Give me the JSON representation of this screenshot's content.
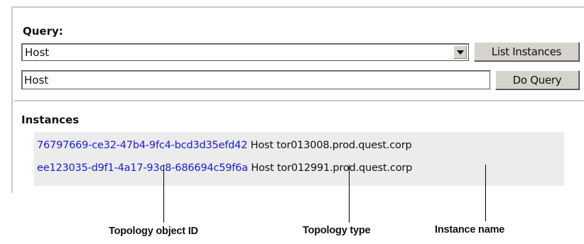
{
  "query": {
    "label": "Query:",
    "select_value": "Host",
    "list_button": "List Instances",
    "input_value": "Host",
    "do_button": "Do Query"
  },
  "instances": {
    "label": "Instances",
    "rows": [
      {
        "id": "76797669-ce32-47b4-9fc4-bcd3d35efd42",
        "type": "Host",
        "name": "tor013008.prod.quest.corp"
      },
      {
        "id": "ee123035-d9f1-4a17-93c8-686694c59f6a",
        "type": "Host",
        "name": "tor012991.prod.quest.corp"
      }
    ]
  },
  "callouts": {
    "id": "Topology object ID",
    "type": "Topology type",
    "name": "Instance name"
  }
}
